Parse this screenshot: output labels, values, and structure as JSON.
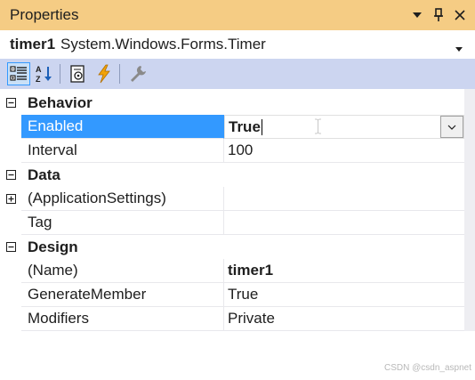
{
  "window": {
    "title": "Properties",
    "colors": {
      "titlebar": "#f5cc84",
      "toolbar": "#ccd5f0",
      "selection": "#3399ff"
    }
  },
  "object_selector": {
    "name": "timer1",
    "type": "System.Windows.Forms.Timer"
  },
  "toolbar": {
    "buttons": [
      "categorized-icon",
      "alphabetical-icon",
      "properties-icon",
      "events-icon",
      "property-pages-icon"
    ]
  },
  "grid": {
    "categories": [
      {
        "label": "Behavior",
        "expanded": true,
        "properties": [
          {
            "name": "Enabled",
            "value": "True",
            "selected": true,
            "bold": true
          },
          {
            "name": "Interval",
            "value": "100"
          }
        ]
      },
      {
        "label": "Data",
        "expanded": true,
        "properties": [
          {
            "name": "(ApplicationSettings)",
            "value": "",
            "expandable": true
          },
          {
            "name": "Tag",
            "value": ""
          }
        ]
      },
      {
        "label": "Design",
        "expanded": true,
        "properties": [
          {
            "name": "(Name)",
            "value": "timer1",
            "bold": true
          },
          {
            "name": "GenerateMember",
            "value": "True"
          },
          {
            "name": "Modifiers",
            "value": "Private"
          }
        ]
      }
    ]
  },
  "watermark": "CSDN @csdn_aspnet"
}
